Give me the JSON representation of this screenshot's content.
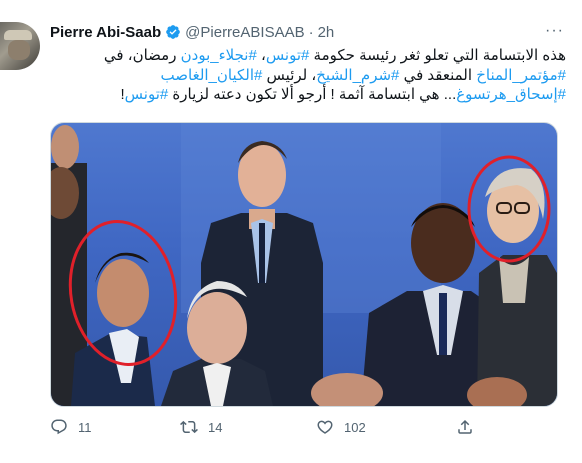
{
  "tweet": {
    "author_name": "Pierre Abi-Saab",
    "handle": "@PierreABISAAB",
    "separator": "·",
    "time": "2h",
    "more_label": "···",
    "text_lines": [
      {
        "parts": [
          {
            "t": "هذه الابتسامة التي تعلو ثغر رئيسة حكومة ",
            "tag": false
          },
          {
            "t": "#تونس",
            "tag": true
          },
          {
            "t": "، ",
            "tag": false
          },
          {
            "t": "#نجلاء_بودن",
            "tag": true
          },
          {
            "t": " رمضان، في",
            "tag": false
          }
        ]
      },
      {
        "parts": [
          {
            "t": "#مؤتمر_المناخ",
            "tag": true
          },
          {
            "t": " المنعقد في ",
            "tag": false
          },
          {
            "t": "#شرم_الشيخ",
            "tag": true
          },
          {
            "t": "، لرئيس ",
            "tag": false
          },
          {
            "t": "#الكيان_الغاصب",
            "tag": true
          }
        ]
      },
      {
        "parts": [
          {
            "t": "#إسحاق_هرتسوغ",
            "tag": true
          },
          {
            "t": "... هي ابتسامة آثمة ! أرجو ألا تكون دعته لزيارة ",
            "tag": false
          },
          {
            "t": "#تونس",
            "tag": true
          },
          {
            "t": "!",
            "tag": false
          }
        ]
      }
    ],
    "actions": {
      "reply_count": "11",
      "retweet_count": "14",
      "like_count": "102"
    }
  },
  "icons": {
    "verified": "verified-badge-icon",
    "reply": "reply-icon",
    "retweet": "retweet-icon",
    "like": "like-icon",
    "share": "share-icon"
  },
  "colors": {
    "accent": "#1d9bf0",
    "text": "#0f1419",
    "muted": "#536471",
    "annotation_circle": "#e0202a"
  }
}
